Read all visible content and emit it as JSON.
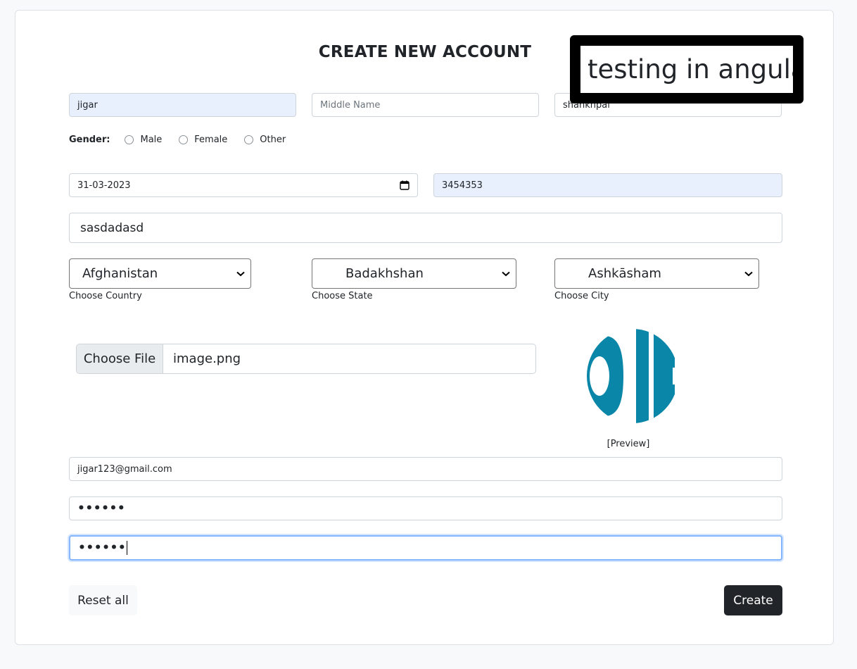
{
  "form": {
    "title": "CREATE NEW ACCOUNT",
    "overlay_text": "testing in angular",
    "first_name": {
      "value": "jigar"
    },
    "middle_name": {
      "value": "",
      "placeholder": "Middle Name"
    },
    "last_name": {
      "value": "shankhpal"
    },
    "gender": {
      "label": "Gender:",
      "options": [
        "Male",
        "Female",
        "Other"
      ]
    },
    "dob": {
      "value": "31-03-2023"
    },
    "phone": {
      "value": "3454353"
    },
    "address": {
      "value": "sasdadasd"
    },
    "country": {
      "value": "Afghanistan",
      "label": "Choose Country"
    },
    "state": {
      "value": "Badakhshan",
      "label": "Choose State"
    },
    "city": {
      "value": "Ashkāsham",
      "label": "Choose City"
    },
    "file": {
      "button_label": "Choose File",
      "file_name": "image.png"
    },
    "preview_caption": "[Preview]",
    "email": {
      "value": "jigar123@gmail.com"
    },
    "password": {
      "masked": "••••••"
    },
    "confirm_password": {
      "masked": "••••••"
    },
    "reset_label": "Reset all",
    "create_label": "Create"
  },
  "colors": {
    "accent_dark": "#212529",
    "autofill_bg": "#e8f0fe",
    "focus_border": "#86b7fe",
    "preview_blue": "#0a86a8"
  },
  "icons": [
    "calendar-icon",
    "chevron-down-icon"
  ]
}
